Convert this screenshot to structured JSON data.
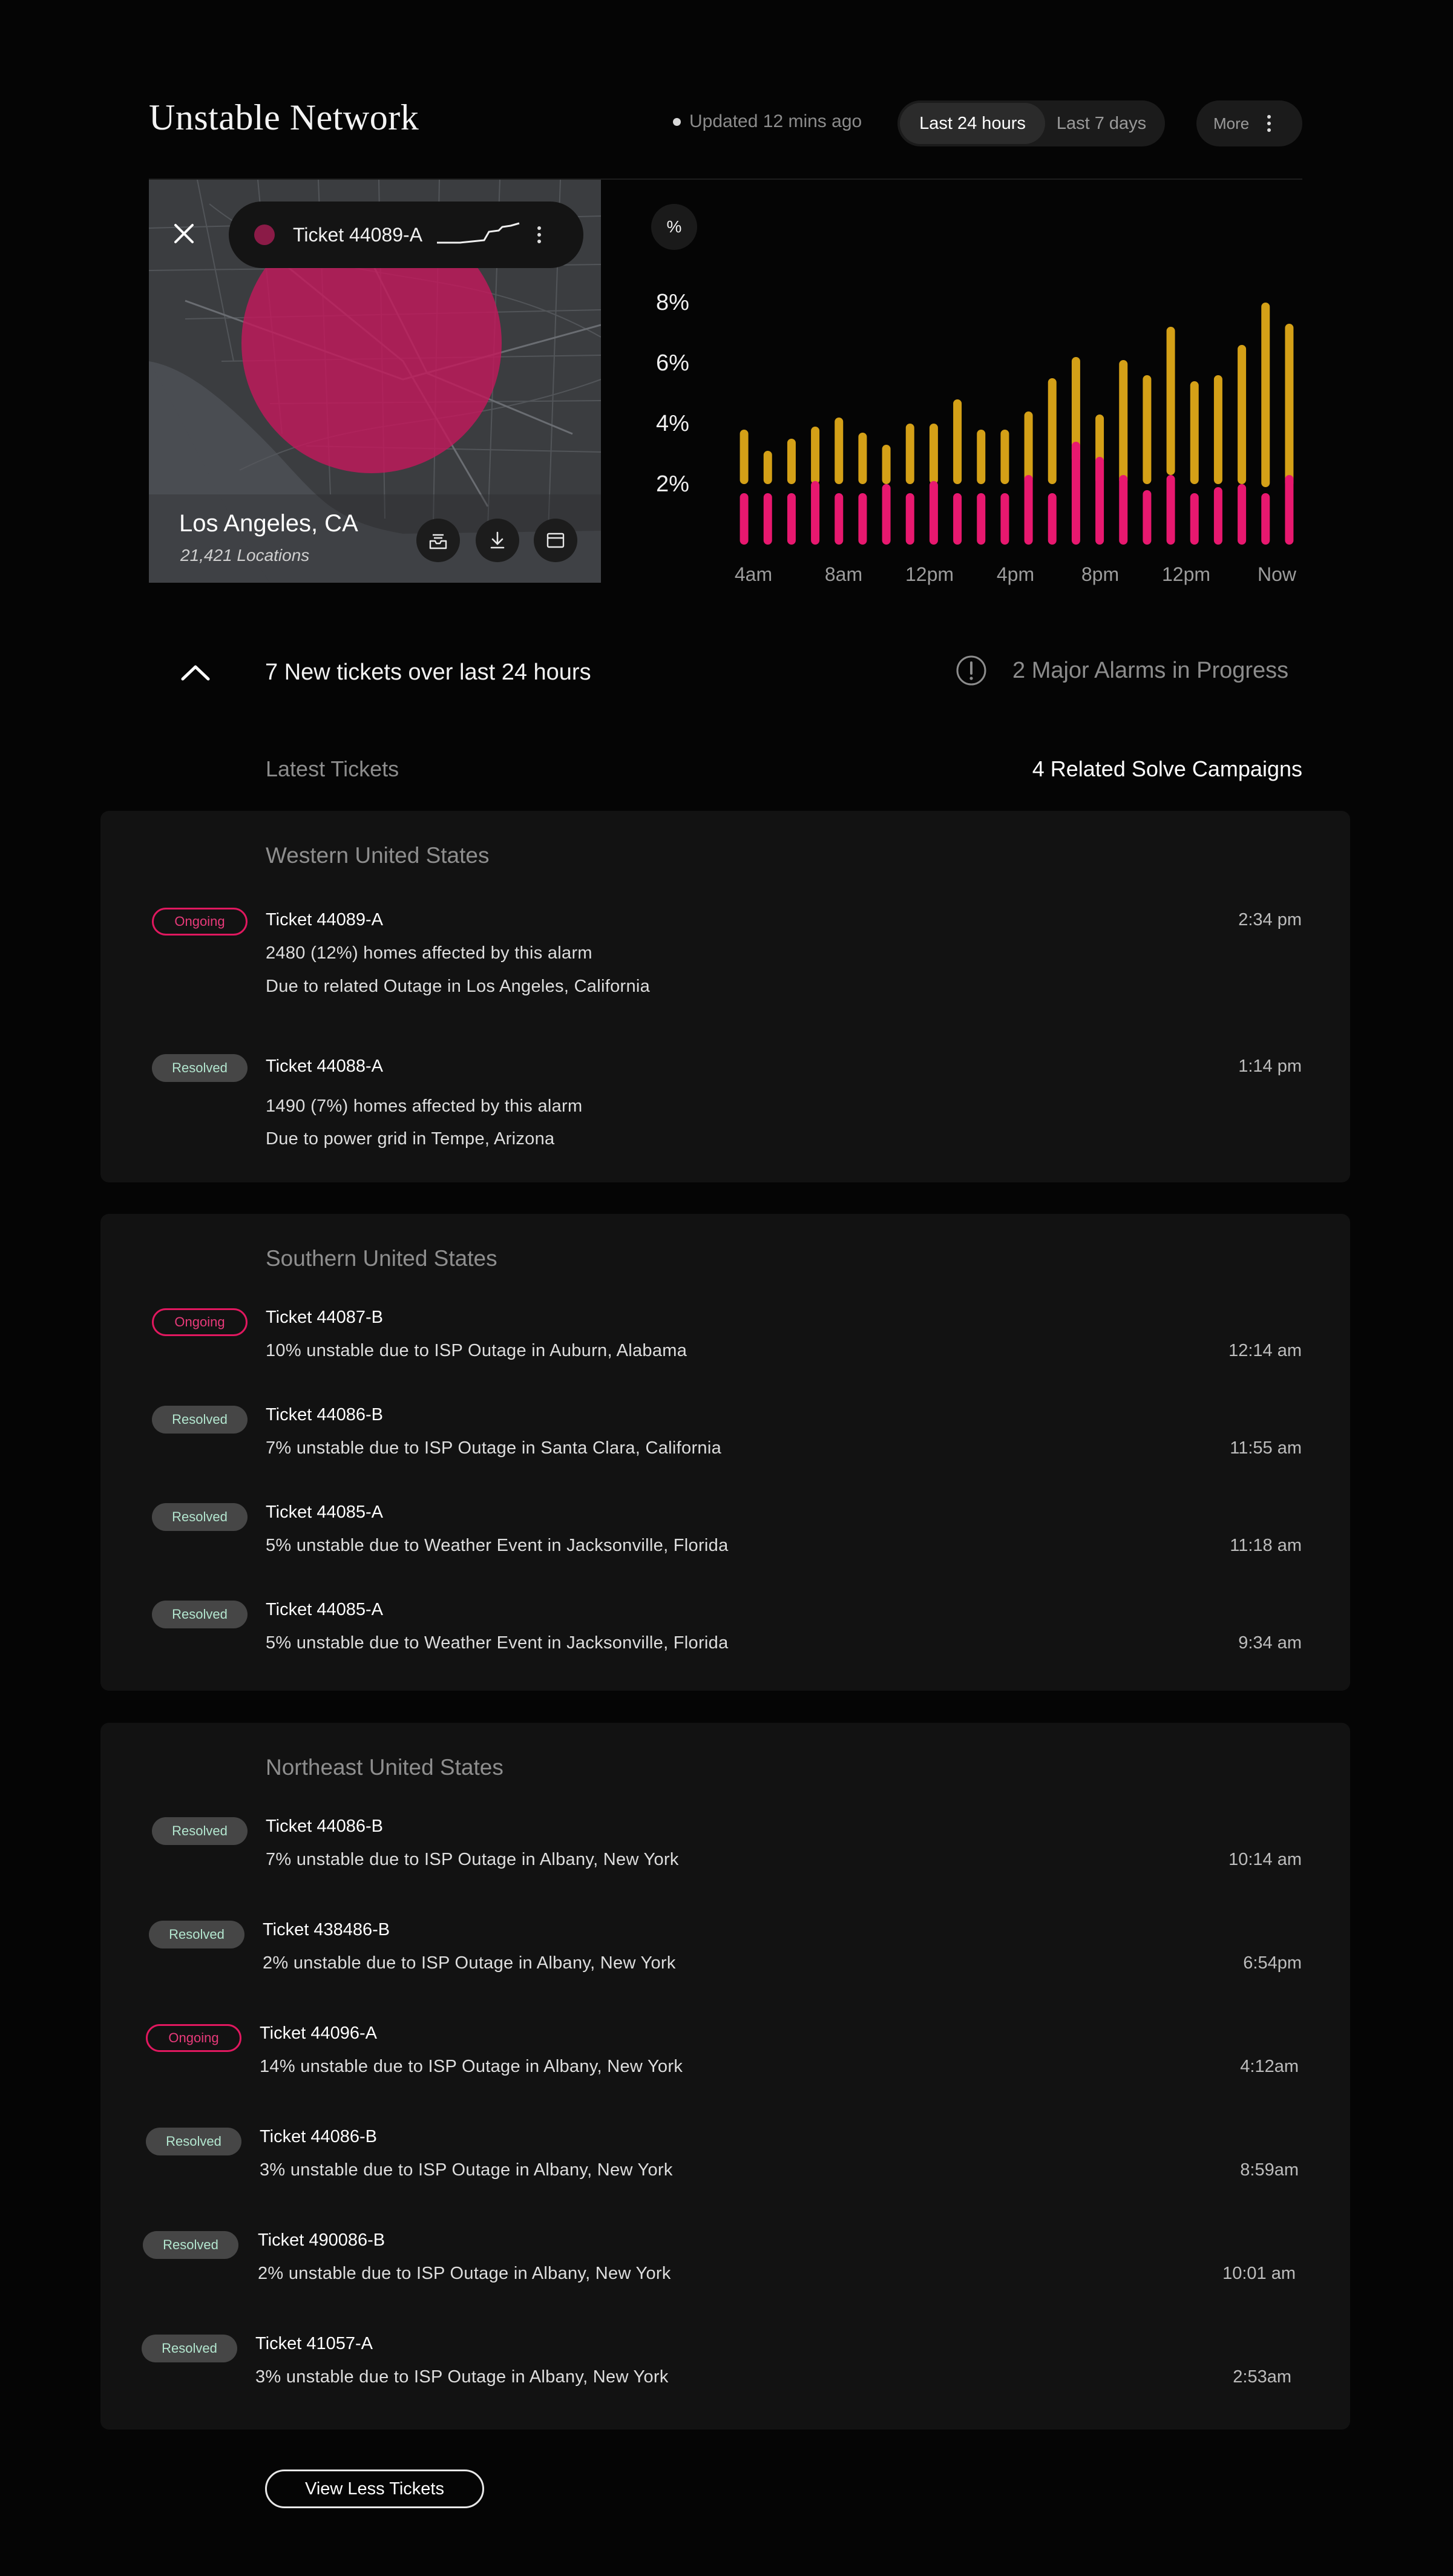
{
  "header": {
    "title": "Unstable Network",
    "updated": "Updated 12 mins ago",
    "range_active": "Last 24 hours",
    "range_other": "Last 7 days",
    "more": "More"
  },
  "map": {
    "ticket_label": "Ticket 44089-A",
    "city": "Los Angeles, CA",
    "locations": "21,421 Locations",
    "circle_color": "#c2185b"
  },
  "chart_data": {
    "type": "bar",
    "ylabel": "%",
    "y_ticks": [
      "8%",
      "6%",
      "4%",
      "2%"
    ],
    "x_ticks": [
      "4am",
      "8am",
      "12pm",
      "4pm",
      "8pm",
      "12pm",
      "Now"
    ],
    "ylim": [
      0,
      9
    ],
    "series": [
      {
        "color": "#d4a017",
        "values": [
          3.8,
          3.1,
          3.5,
          3.9,
          4.2,
          3.7,
          3.3,
          4.0,
          4.0,
          4.8,
          3.8,
          3.8,
          4.4,
          5.5,
          6.2,
          4.3,
          6.1,
          5.6,
          7.2,
          5.4,
          5.6,
          6.6,
          8.0,
          7.3
        ],
        "lower": [
          2.0,
          2.0,
          2.0,
          2.0,
          2.0,
          2.0,
          2.0,
          2.0,
          2.0,
          2.0,
          2.0,
          2.0,
          2.0,
          2.0,
          2.7,
          2.0,
          2.0,
          2.0,
          2.3,
          2.0,
          2.0,
          2.0,
          1.9,
          1.9
        ]
      },
      {
        "color": "#e8186f",
        "values": [
          1.7,
          1.7,
          1.7,
          2.1,
          1.7,
          1.7,
          2.0,
          1.7,
          2.1,
          1.7,
          1.7,
          1.7,
          2.3,
          1.7,
          3.4,
          2.9,
          2.3,
          1.8,
          2.3,
          1.7,
          1.9,
          2.0,
          1.7,
          2.3
        ]
      }
    ]
  },
  "summary": {
    "new_tickets": "7 New tickets over last 24 hours",
    "alarms": "2 Major Alarms in Progress",
    "latest": "Latest Tickets",
    "campaigns": "4 Related Solve Campaigns"
  },
  "status": {
    "ongoing": "Ongoing",
    "resolved": "Resolved"
  },
  "regions": [
    {
      "title": "Western United States",
      "tickets": [
        {
          "status": "Ongoing",
          "title": "Ticket 44089-A",
          "line1": "2480 (12%) homes affected by this alarm",
          "line2": "Due to related Outage in Los Angeles, California",
          "time": "2:34 pm"
        },
        {
          "status": "Resolved",
          "title": "Ticket 44088-A",
          "line1": "1490 (7%) homes affected by this alarm",
          "line2": "Due to power grid in Tempe, Arizona",
          "time": "1:14 pm"
        }
      ]
    },
    {
      "title": "Southern United States",
      "tickets": [
        {
          "status": "Ongoing",
          "title": "Ticket 44087-B",
          "line1": "10% unstable due to ISP Outage in Auburn, Alabama",
          "time": "12:14 am"
        },
        {
          "status": "Resolved",
          "title": "Ticket 44086-B",
          "line1": "7% unstable due to ISP Outage in Santa Clara, California",
          "time": "11:55 am"
        },
        {
          "status": "Resolved",
          "title": "Ticket 44085-A",
          "line1": "5% unstable due to Weather Event in Jacksonville, Florida",
          "time": "11:18 am"
        },
        {
          "status": "Resolved",
          "title": "Ticket 44085-A",
          "line1": "5% unstable due to Weather Event in Jacksonville, Florida",
          "time": "9:34 am"
        }
      ]
    },
    {
      "title": "Northeast United States",
      "tickets": [
        {
          "status": "Resolved",
          "title": "Ticket 44086-B",
          "line1": "7% unstable due to ISP Outage in Albany, New York",
          "time": "10:14 am"
        },
        {
          "status": "Resolved",
          "title": "Ticket 438486-B",
          "line1": "2% unstable due to ISP Outage in Albany, New York",
          "time": "6:54pm"
        },
        {
          "status": "Ongoing",
          "title": "Ticket 44096-A",
          "line1": "14% unstable due to ISP Outage in Albany, New York",
          "time": "4:12am"
        },
        {
          "status": "Resolved",
          "title": "Ticket 44086-B",
          "line1": "3% unstable due to ISP Outage in Albany, New York",
          "time": "8:59am"
        },
        {
          "status": "Resolved",
          "title": "Ticket 490086-B",
          "line1": "2% unstable due to ISP Outage in Albany, New York",
          "time": "10:01 am"
        },
        {
          "status": "Resolved",
          "title": "Ticket 41057-A",
          "line1": "3% unstable due to ISP Outage in Albany, New York",
          "time": "2:53am"
        }
      ]
    }
  ],
  "footer": {
    "view_less": "View Less Tickets"
  }
}
